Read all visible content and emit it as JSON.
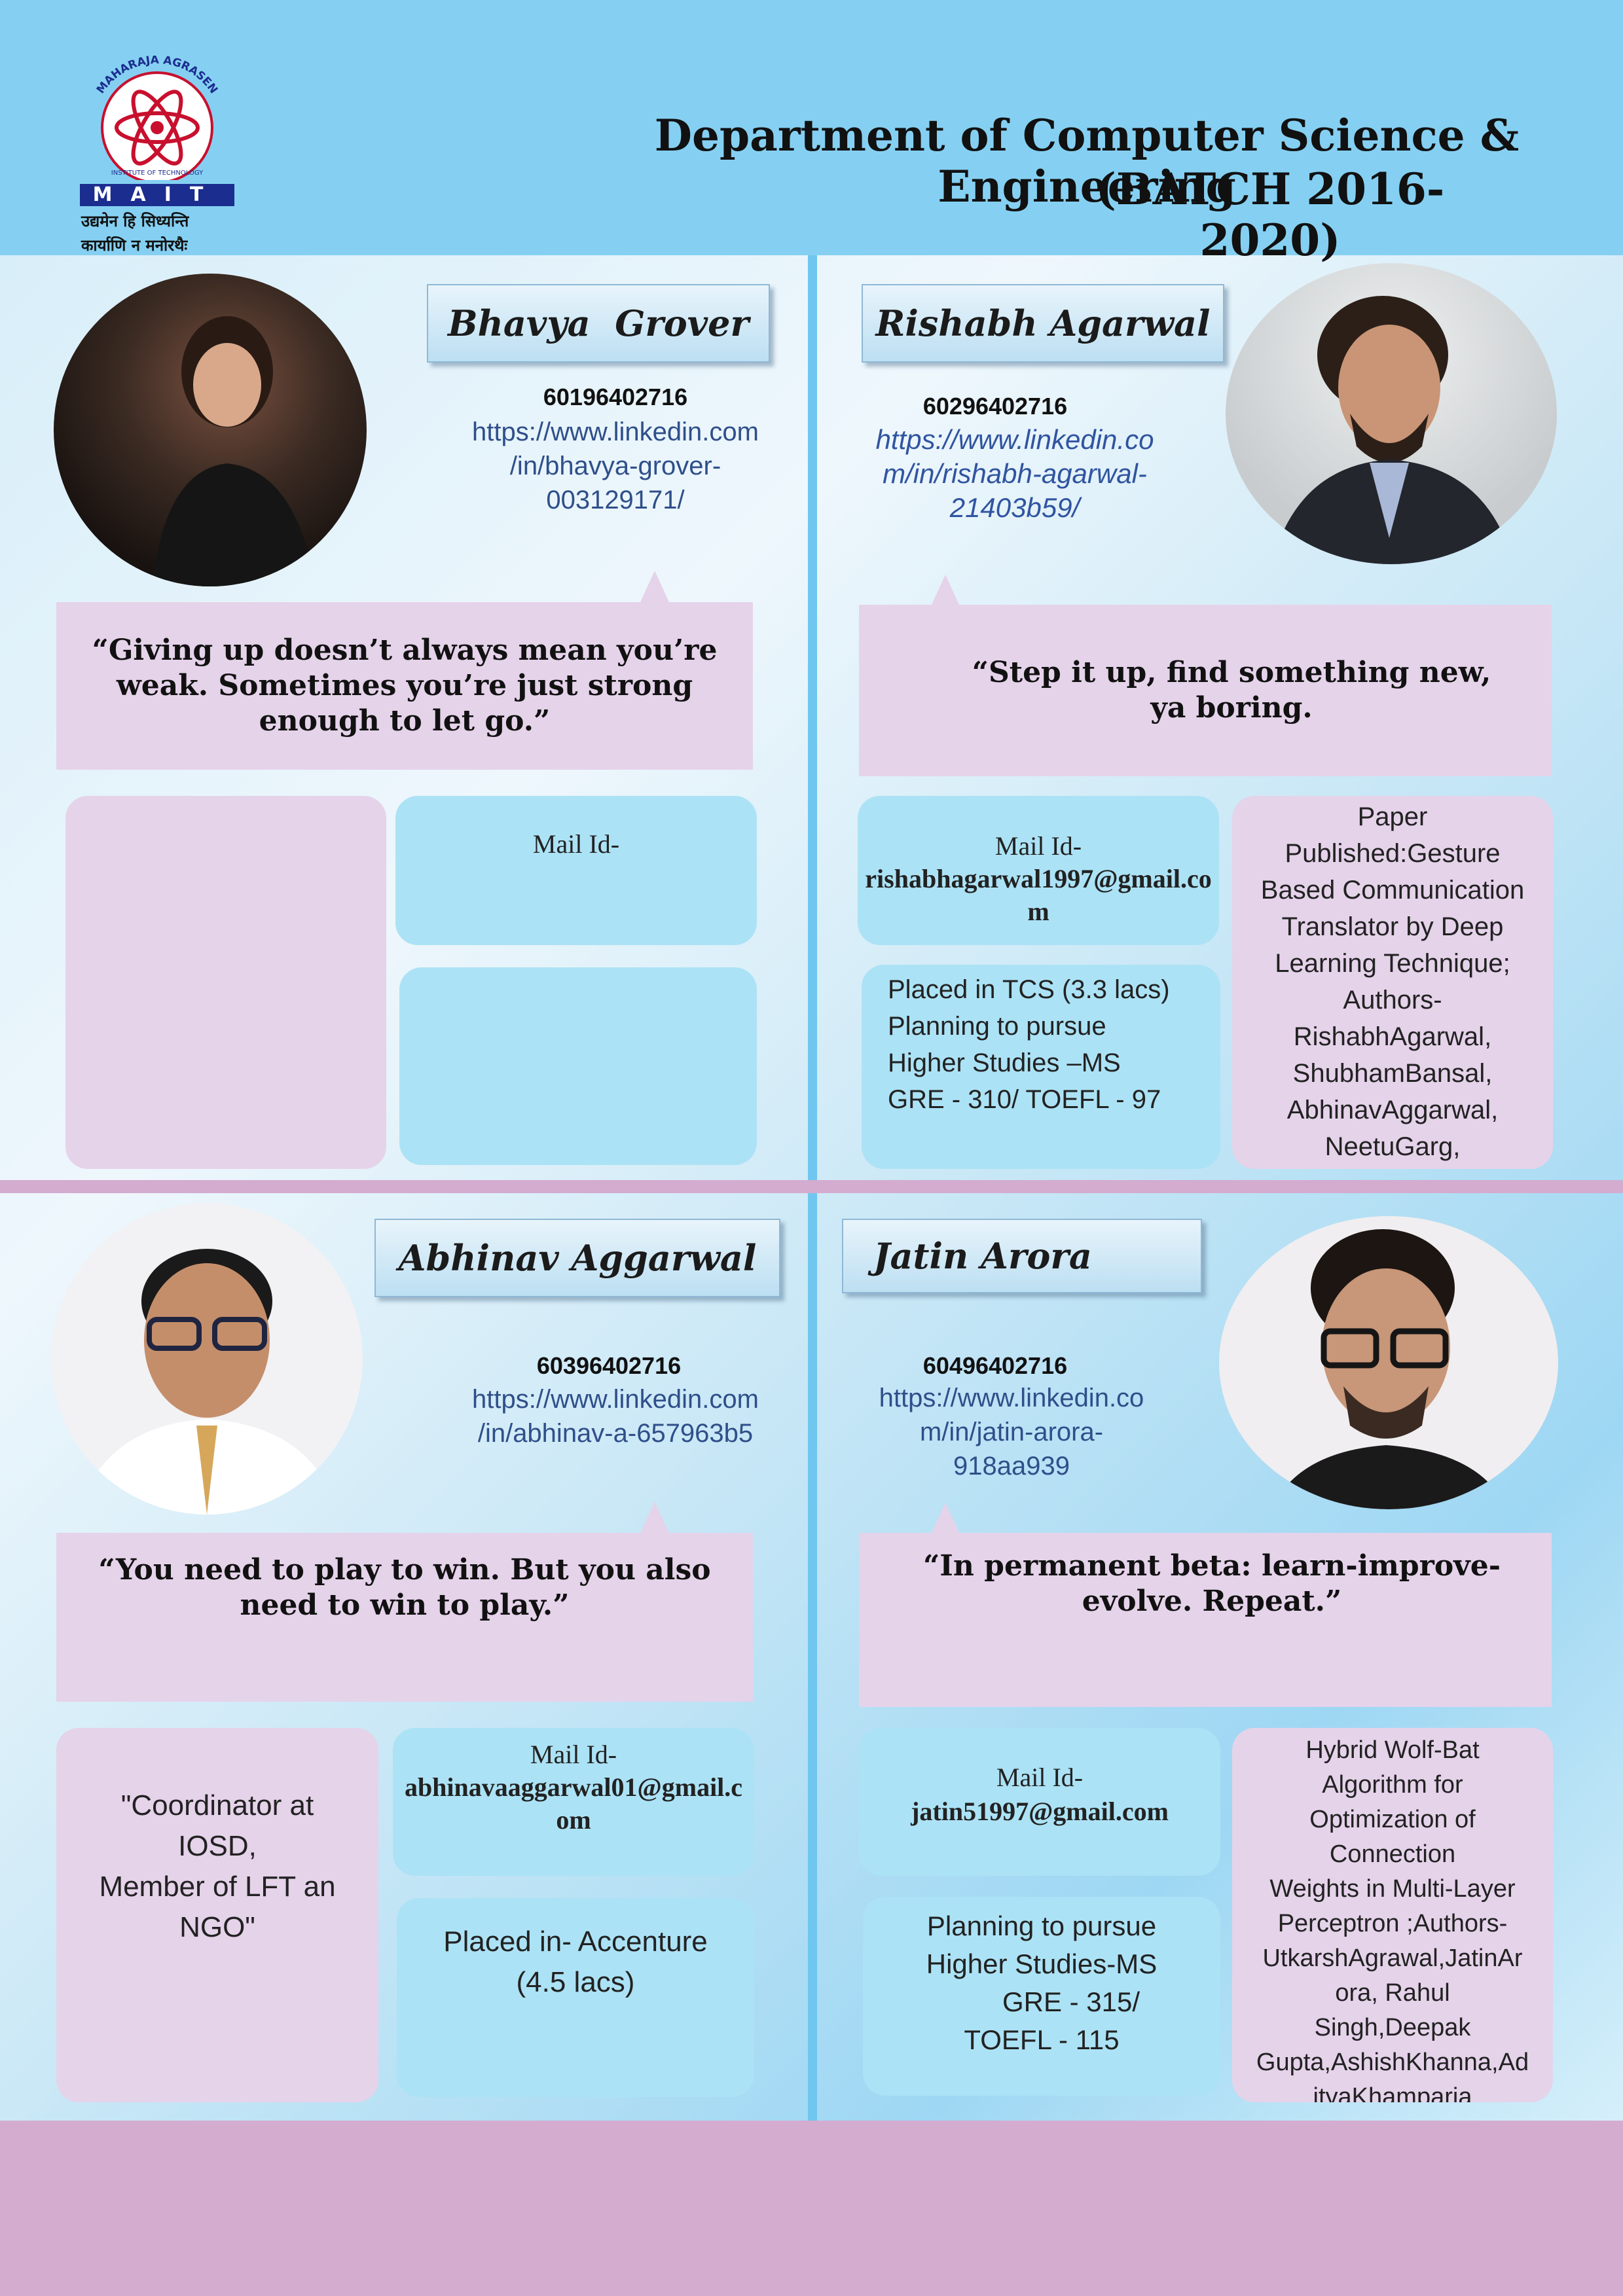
{
  "header": {
    "title_line1": "Department of Computer Science & Engineering",
    "title_line2": "(BATCH 2016-2020)",
    "logo": {
      "arc_text": "MAHARAJA AGRASEN",
      "inner_text": "INSTITUTE OF TECHNOLOGY",
      "acronym": "MAIT",
      "motto_line1": "उद्यमेन हि सिध्यन्ति",
      "motto_line2": "कार्याणि न मनोरथैः"
    }
  },
  "students": [
    {
      "name": "Bhavya  Grover",
      "roll": "60196402716",
      "linkedin": [
        "https://www.linkedin.com",
        "/in/bhavya-grover-",
        "003129171/"
      ],
      "quote": "“Giving up doesn’t always mean you’re weak. Sometimes you’re just strong enough to let go.”",
      "mail_label": "Mail Id-",
      "mail": "",
      "info": "",
      "side": ""
    },
    {
      "name": "Rishabh Agarwal",
      "roll": "60296402716",
      "linkedin": [
        "https://www.linkedin.co",
        "m/in/rishabh-agarwal-",
        "21403b59/"
      ],
      "quote": "“Step it up, find something new, ya boring.",
      "mail_label": "Mail Id-",
      "mail": "rishabhagarwal1997@gmail.com",
      "info": [
        "Placed in TCS (3.3 lacs)",
        "Planning to pursue",
        "Higher Studies –MS",
        "GRE - 310/ TOEFL - 97"
      ],
      "side": [
        "Paper",
        "Published:Gesture",
        "Based Communication",
        "Translator by Deep",
        "Learning Technique;",
        "Authors-",
        "RishabhAgarwal,",
        "ShubhamBansal,",
        "AbhinavAggarwal,",
        "NeetuGarg,"
      ]
    },
    {
      "name": "Abhinav Aggarwal",
      "roll": "60396402716",
      "linkedin": [
        "https://www.linkedin.com",
        "/in/abhinav-a-657963b5"
      ],
      "quote": "“You need to play to win. But you also need to win to play.”",
      "mail_label": "Mail Id-",
      "mail": "abhinavaaggarwal01@gmail.com",
      "info": [
        "Placed in- Accenture",
        "(4.5 lacs)"
      ],
      "side": [
        "\"Coordinator at",
        "IOSD,",
        "Member of LFT an",
        "NGO\""
      ]
    },
    {
      "name": "Jatin Arora",
      "roll": "60496402716",
      "linkedin": [
        "https://www.linkedin.co",
        "m/in/jatin-arora-",
        "918aa939"
      ],
      "quote": "“In permanent beta: learn-improve-evolve. Repeat.”",
      "mail_label": "Mail Id-",
      "mail": "jatin51997@gmail.com",
      "info": [
        "Planning to pursue",
        "Higher Studies-MS",
        "GRE - 315/",
        "TOEFL - 115"
      ],
      "side": [
        "Hybrid Wolf-Bat",
        "Algorithm for",
        "Optimization of",
        "Connection",
        "Weights in Multi-Layer",
        "Perceptron ;Authors-",
        "UtkarshAgrawal,JatinAr",
        "ora, Rahul",
        "Singh,Deepak",
        "Gupta,AshishKhanna,Ad",
        "ityaKhamparia"
      ]
    }
  ]
}
